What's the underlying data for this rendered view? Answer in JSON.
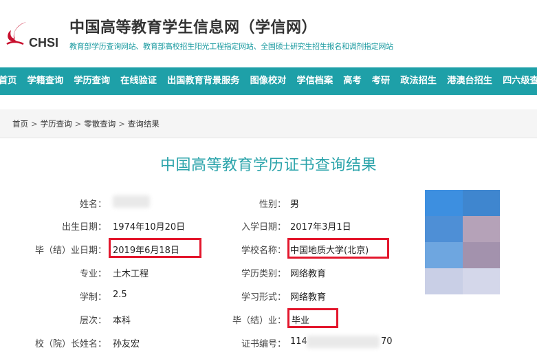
{
  "header": {
    "logo_text": "CHSI",
    "site_title": "中国高等教育学生信息网（学信网）",
    "site_subtitle": "教育部学历查询网站、教育部高校招生阳光工程指定网站、全国硕士研究生招生报名和调剂指定网站"
  },
  "nav": {
    "items": [
      "首页",
      "学籍查询",
      "学历查询",
      "在线验证",
      "出国教育背景服务",
      "图像校对",
      "学信档案",
      "高考",
      "考研",
      "政法招生",
      "港澳台招生",
      "四六级查分"
    ]
  },
  "breadcrumb": {
    "items": [
      "首页",
      "学历查询",
      "零散查询",
      "查询结果"
    ],
    "separator": ">"
  },
  "result": {
    "title": "中国高等教育学历证书查询结果",
    "left_fields": [
      {
        "label": "姓名：",
        "value": ""
      },
      {
        "label": "出生日期：",
        "value": "1974年10月20日"
      },
      {
        "label": "毕（结）业日期：",
        "value": "2019年6月18日"
      },
      {
        "label": "专业：",
        "value": "土木工程"
      },
      {
        "label": "学制：",
        "value": "2.5"
      },
      {
        "label": "层次：",
        "value": "本科"
      },
      {
        "label": "校（院）长姓名：",
        "value": "孙友宏"
      }
    ],
    "right_fields": [
      {
        "label": "性别：",
        "value": "男"
      },
      {
        "label": "入学日期：",
        "value": "2017年3月1日"
      },
      {
        "label": "学校名称：",
        "value": "中国地质大学(北京)"
      },
      {
        "label": "学历类别：",
        "value": "网络教育"
      },
      {
        "label": "学习形式：",
        "value": "网络教育"
      },
      {
        "label": "毕（结）业：",
        "value": "毕业"
      },
      {
        "label": "证书编号：",
        "value_prefix": "114",
        "value_suffix": "70"
      }
    ]
  },
  "colors": {
    "nav_bg": "#1ea0a8",
    "title_color": "#2aa3aa",
    "highlight": "#e3162c",
    "subtitle_color": "#1a9aa0"
  }
}
